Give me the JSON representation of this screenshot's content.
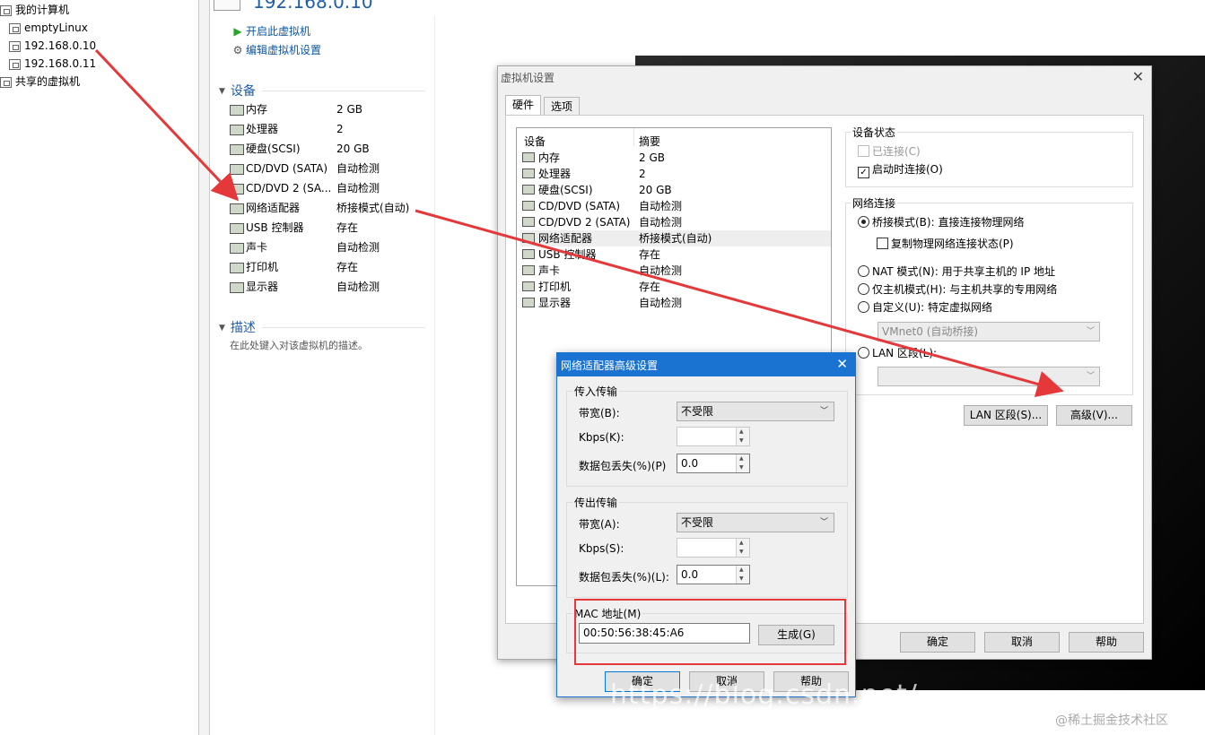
{
  "tree": {
    "root": "我的计算机",
    "items": [
      "emptyLinux",
      "192.168.0.10",
      "192.168.0.11"
    ],
    "shared": "共享的虚拟机"
  },
  "header": {
    "title": "192.168.0.10"
  },
  "actions": {
    "power_on": "开启此虚拟机",
    "edit": "编辑虚拟机设置"
  },
  "sections": {
    "devices": "设备",
    "description": "描述",
    "description_placeholder": "在此处键入对该虚拟机的描述。"
  },
  "devices": [
    {
      "name": "内存",
      "value": "2 GB"
    },
    {
      "name": "处理器",
      "value": "2"
    },
    {
      "name": "硬盘(SCSI)",
      "value": "20 GB"
    },
    {
      "name": "CD/DVD (SATA)",
      "value": "自动检测"
    },
    {
      "name": "CD/DVD 2 (SA...",
      "value": "自动检测"
    },
    {
      "name": "网络适配器",
      "value": "桥接模式(自动)"
    },
    {
      "name": "USB 控制器",
      "value": "存在"
    },
    {
      "name": "声卡",
      "value": "自动检测"
    },
    {
      "name": "打印机",
      "value": "存在"
    },
    {
      "name": "显示器",
      "value": "自动检测"
    }
  ],
  "settings": {
    "title": "虚拟机设置",
    "tabs": [
      "硬件",
      "选项"
    ],
    "col_device": "设备",
    "col_summary": "摘要",
    "hardware": [
      {
        "name": "内存",
        "value": "2 GB"
      },
      {
        "name": "处理器",
        "value": "2"
      },
      {
        "name": "硬盘(SCSI)",
        "value": "20 GB"
      },
      {
        "name": "CD/DVD (SATA)",
        "value": "自动检测"
      },
      {
        "name": "CD/DVD 2 (SATA)",
        "value": "自动检测"
      },
      {
        "name": "网络适配器",
        "value": "桥接模式(自动)"
      },
      {
        "name": "USB 控制器",
        "value": "存在"
      },
      {
        "name": "声卡",
        "value": "自动检测"
      },
      {
        "name": "打印机",
        "value": "存在"
      },
      {
        "name": "显示器",
        "value": "自动检测"
      }
    ],
    "device_status": {
      "title": "设备状态",
      "connected": "已连接(C)",
      "connect_on_start": "启动时连接(O)"
    },
    "network": {
      "title": "网络连接",
      "bridged": "桥接模式(B): 直接连接物理网络",
      "replicate": "复制物理网络连接状态(P)",
      "nat": "NAT 模式(N): 用于共享主机的 IP 地址",
      "host_only": "仅主机模式(H): 与主机共享的专用网络",
      "custom": "自定义(U): 特定虚拟网络",
      "vmnet": "VMnet0 (自动桥接)",
      "lan": "LAN 区段(L):"
    },
    "buttons": {
      "lan_segments": "LAN 区段(S)...",
      "advanced": "高级(V)...",
      "ok": "确定",
      "cancel": "取消",
      "help": "帮助"
    }
  },
  "advanced": {
    "title": "网络适配器高级设置",
    "incoming": {
      "title": "传入传输",
      "bandwidth_label": "带宽(B):",
      "bandwidth": "不受限",
      "kbps_label": "Kbps(K):",
      "loss_label": "数据包丢失(%)(P)",
      "loss": "0.0"
    },
    "outgoing": {
      "title": "传出传输",
      "bandwidth_label": "带宽(A):",
      "bandwidth": "不受限",
      "kbps_label": "Kbps(S):",
      "loss_label": "数据包丢失(%)(L):",
      "loss": "0.0"
    },
    "mac": {
      "title": "MAC 地址(M)",
      "value": "00:50:56:38:45:A6",
      "generate": "生成(G)"
    },
    "buttons": {
      "ok": "确定",
      "cancel": "取消",
      "help": "帮助"
    }
  },
  "watermark": "https://blog.csdn.net/...",
  "credit": "@稀土掘金技术社区",
  "colors": {
    "accent": "#1a73d0",
    "link": "#1f5fa8",
    "annotation": "#e5383b"
  }
}
